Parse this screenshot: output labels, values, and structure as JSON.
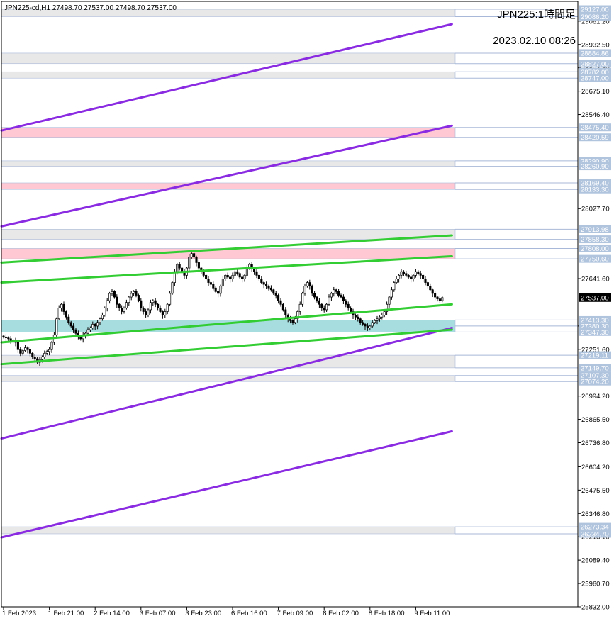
{
  "header": {
    "symbol_line": "JPN225-cd,H1  27498.70 27537.00 27498.70 27537.00",
    "chart_title": "JPN225:1時間足",
    "timestamp": "2023.02.10 08:26"
  },
  "colors": {
    "background": "#ffffff",
    "axis": "#000000",
    "bull_candle": "#ffffff",
    "bear_candle": "#000000",
    "purple_line": "#8a2be2",
    "green_line": "#32cd32",
    "zone_gray": "#e8e8e8",
    "zone_pink": "#ffc8d2",
    "zone_cyan": "#a8dde0",
    "level_line": "#a8b8d8",
    "level_label_bg": "#b0c4de",
    "current_price_bg": "#000000"
  },
  "chart_data": {
    "type": "candlestick",
    "y_range": [
      25832.0,
      29170.0
    ],
    "x_range": [
      0,
      188
    ],
    "grid": false,
    "current_price": "27537.00",
    "price_ticks": [
      "29061.20",
      "28932.50",
      "28803.80",
      "28675.10",
      "28546.40",
      "28027.70",
      "27641.60",
      "27380.30",
      "27251.60",
      "26994.20",
      "26865.50",
      "26736.80",
      "26604.20",
      "26475.50",
      "26346.80",
      "26218.10",
      "26089.40",
      "25960.70",
      "25832.00"
    ],
    "level_labels": [
      "29127.00",
      "29086.20",
      "28884.86",
      "28827.00",
      "28782.00",
      "28747.00",
      "28475.40",
      "28420.59",
      "28290.90",
      "28260.90",
      "28169.40",
      "28133.30",
      "27913.98",
      "27858.30",
      "27808.00",
      "27750.60",
      "27413.30",
      "27380.30",
      "27347.30",
      "27219.11",
      "27149.70",
      "27107.30",
      "27074.20",
      "26273.34",
      "26234.70"
    ],
    "time_labels": [
      {
        "label": "1 Feb 2023",
        "bar": 0
      },
      {
        "label": "1 Feb 21:00",
        "bar": 19
      },
      {
        "label": "2 Feb 14:00",
        "bar": 38
      },
      {
        "label": "3 Feb 07:00",
        "bar": 57
      },
      {
        "label": "3 Feb 23:00",
        "bar": 76
      },
      {
        "label": "6 Feb 16:00",
        "bar": 95
      },
      {
        "label": "7 Feb 09:00",
        "bar": 114
      },
      {
        "label": "8 Feb 02:00",
        "bar": 133
      },
      {
        "label": "8 Feb 18:00",
        "bar": 152
      },
      {
        "label": "9 Feb 11:00",
        "bar": 171
      }
    ],
    "zones": [
      {
        "from": 29086.2,
        "to": 29127.0,
        "kind": "gray"
      },
      {
        "from": 28827.0,
        "to": 28884.86,
        "kind": "gray"
      },
      {
        "from": 28747.0,
        "to": 28782.0,
        "kind": "gray"
      },
      {
        "from": 28420.59,
        "to": 28475.4,
        "kind": "pink"
      },
      {
        "from": 28260.9,
        "to": 28290.9,
        "kind": "gray"
      },
      {
        "from": 28133.3,
        "to": 28169.4,
        "kind": "pink"
      },
      {
        "from": 27858.3,
        "to": 27913.98,
        "kind": "gray"
      },
      {
        "from": 27750.6,
        "to": 27808.0,
        "kind": "pink"
      },
      {
        "from": 27347.3,
        "to": 27413.3,
        "kind": "cyan"
      },
      {
        "from": 27149.7,
        "to": 27219.11,
        "kind": "gray"
      },
      {
        "from": 27074.2,
        "to": 27107.3,
        "kind": "gray"
      },
      {
        "from": 26234.7,
        "to": 26273.34,
        "kind": "gray"
      }
    ],
    "trend_lines": [
      {
        "kind": "purple",
        "from": [
          0,
          28458
        ],
        "to": [
          186,
          29045
        ]
      },
      {
        "kind": "purple",
        "from": [
          0,
          27930
        ],
        "to": [
          186,
          28485
        ]
      },
      {
        "kind": "purple",
        "from": [
          0,
          26760
        ],
        "to": [
          186,
          27370
        ]
      },
      {
        "kind": "purple",
        "from": [
          0,
          26215
        ],
        "to": [
          186,
          26800
        ]
      },
      {
        "kind": "green",
        "from": [
          0,
          27730
        ],
        "to": [
          186,
          27880
        ]
      },
      {
        "kind": "green",
        "from": [
          0,
          27620
        ],
        "to": [
          186,
          27765
        ]
      },
      {
        "kind": "green",
        "from": [
          0,
          27290
        ],
        "to": [
          186,
          27500
        ]
      },
      {
        "kind": "green",
        "from": [
          0,
          27170
        ],
        "to": [
          186,
          27360
        ]
      }
    ],
    "closes": [
      27320,
      27315,
      27310,
      27295,
      27300,
      27290,
      27250,
      27230,
      27245,
      27260,
      27250,
      27230,
      27210,
      27200,
      27180,
      27195,
      27210,
      27230,
      27240,
      27250,
      27290,
      27330,
      27420,
      27480,
      27500,
      27460,
      27430,
      27400,
      27380,
      27360,
      27340,
      27320,
      27310,
      27330,
      27340,
      27360,
      27370,
      27390,
      27380,
      27400,
      27420,
      27440,
      27480,
      27520,
      27560,
      27570,
      27540,
      27500,
      27480,
      27460,
      27480,
      27510,
      27540,
      27560,
      27570,
      27550,
      27520,
      27480,
      27460,
      27440,
      27470,
      27510,
      27520,
      27500,
      27480,
      27460,
      27440,
      27460,
      27500,
      27560,
      27620,
      27680,
      27720,
      27700,
      27680,
      27660,
      27700,
      27760,
      27780,
      27760,
      27730,
      27700,
      27680,
      27660,
      27640,
      27620,
      27610,
      27590,
      27570,
      27560,
      27600,
      27640,
      27660,
      27650,
      27640,
      27660,
      27680,
      27670,
      27650,
      27640,
      27660,
      27700,
      27720,
      27700,
      27680,
      27660,
      27640,
      27620,
      27610,
      27600,
      27590,
      27580,
      27560,
      27550,
      27520,
      27500,
      27470,
      27440,
      27420,
      27410,
      27400,
      27420,
      27460,
      27500,
      27560,
      27600,
      27620,
      27600,
      27560,
      27540,
      27520,
      27500,
      27480,
      27470,
      27500,
      27540,
      27560,
      27580,
      27570,
      27550,
      27540,
      27520,
      27500,
      27480,
      27460,
      27440,
      27430,
      27420,
      27400,
      27390,
      27380,
      27370,
      27380,
      27400,
      27410,
      27420,
      27430,
      27440,
      27460,
      27500,
      27540,
      27580,
      27620,
      27640,
      27660,
      27680,
      27670,
      27660,
      27650,
      27640,
      27660,
      27680,
      27670,
      27660,
      27640,
      27620,
      27600,
      27580,
      27560,
      27540,
      27530,
      27520,
      27537
    ]
  }
}
